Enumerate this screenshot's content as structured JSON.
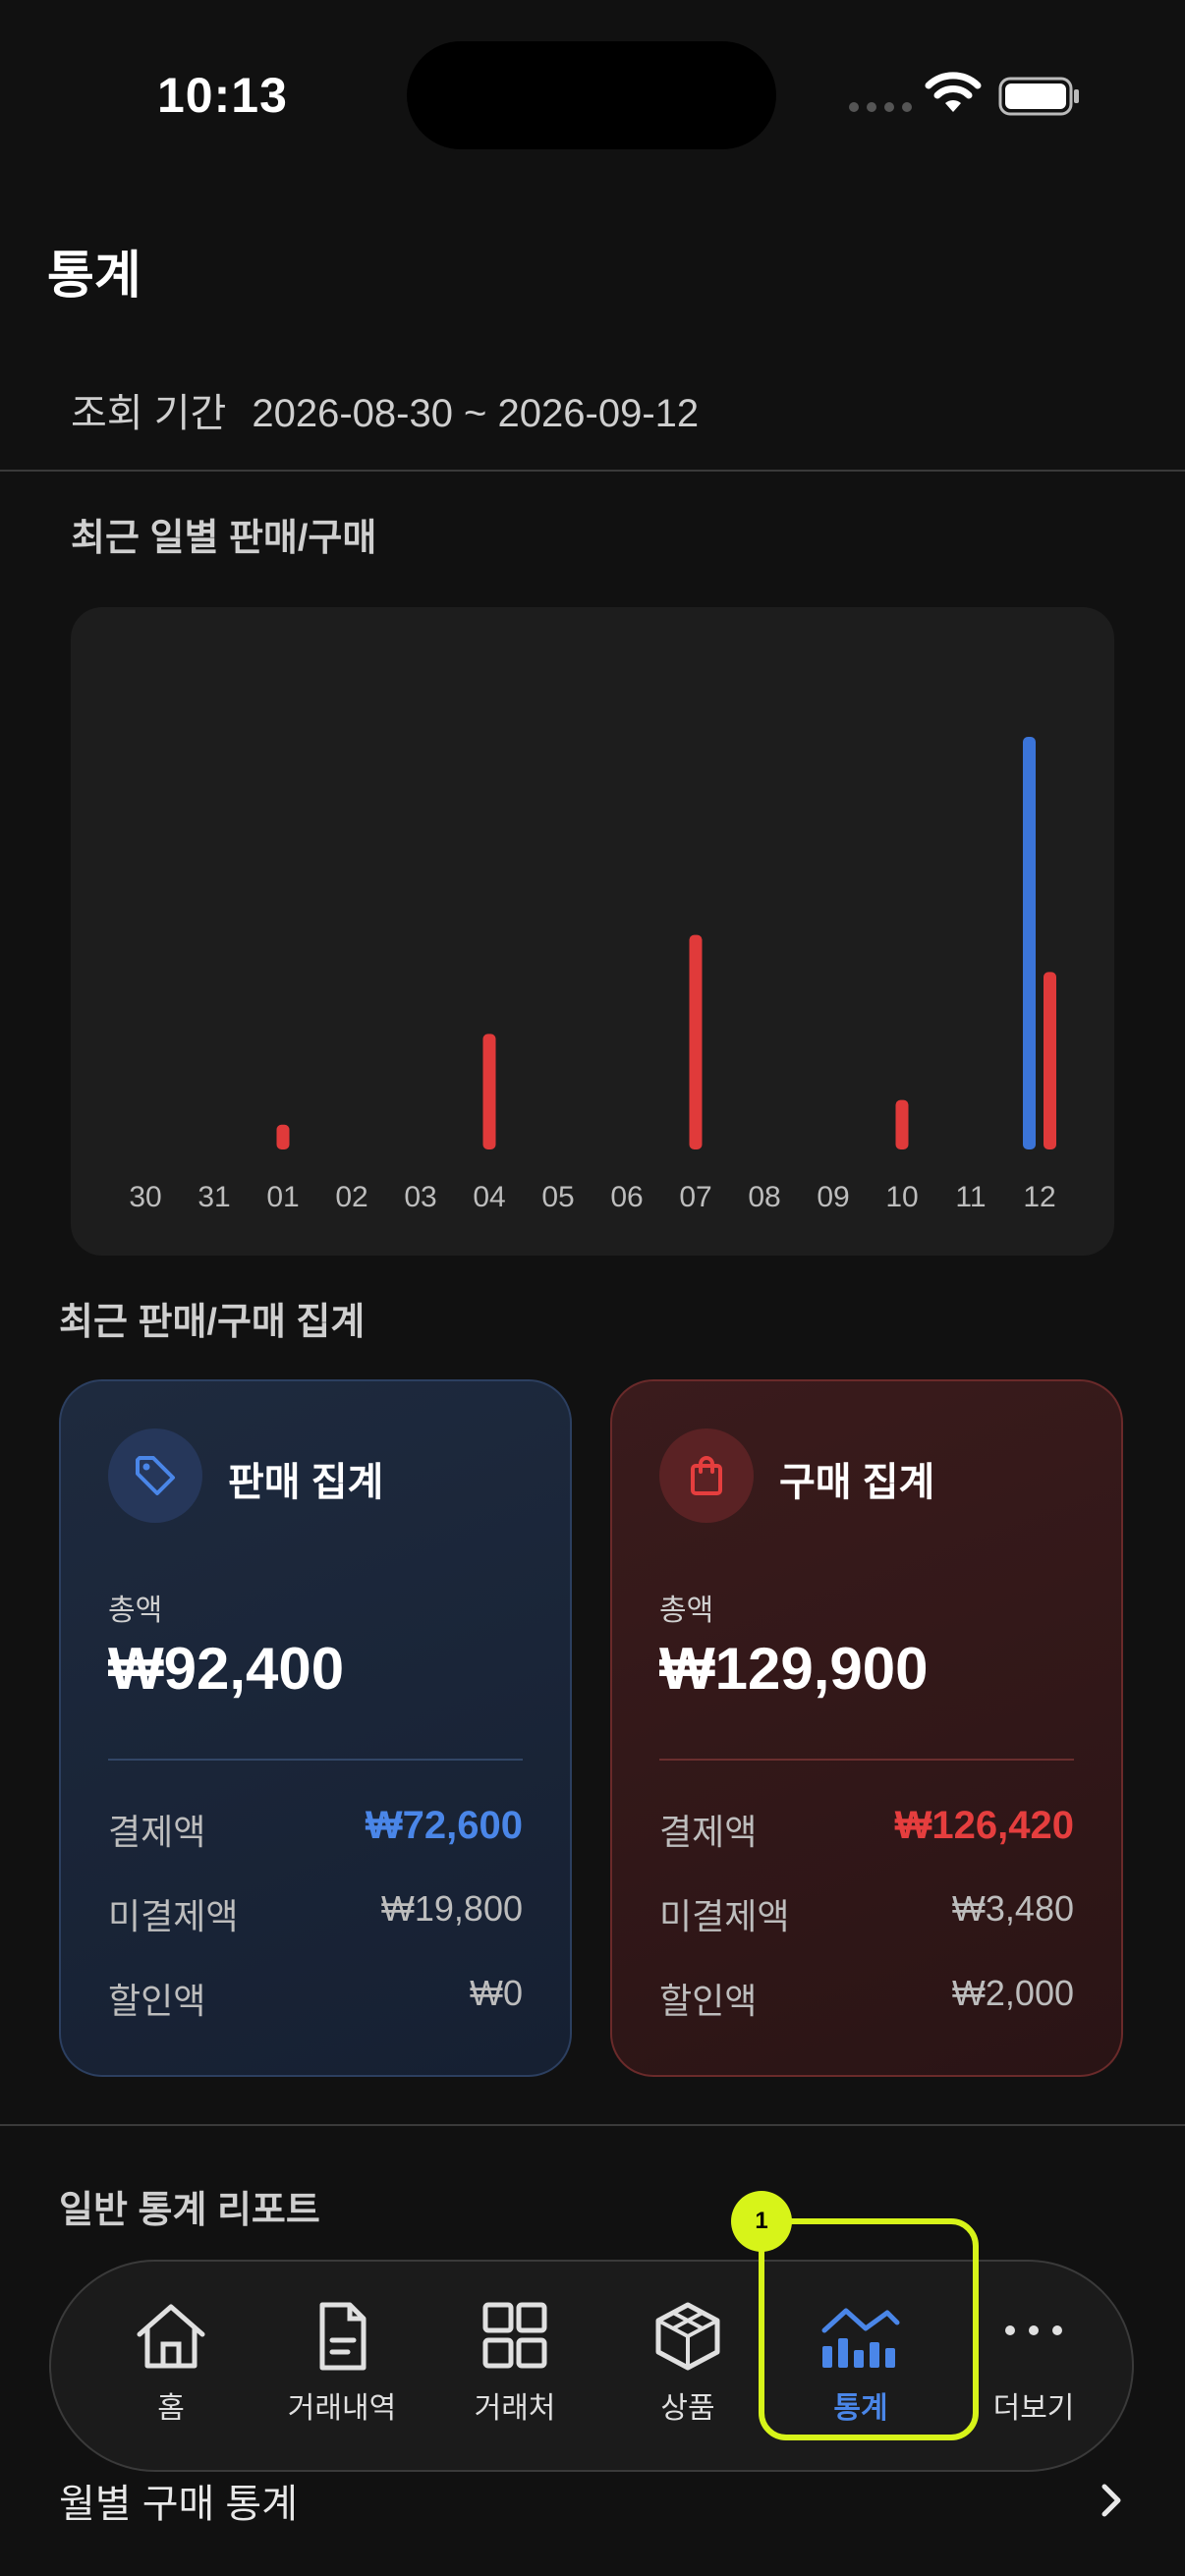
{
  "status_bar": {
    "time": "10:13"
  },
  "page": {
    "title": "통계",
    "period_label": "조회 기간",
    "period_value": "2026-08-30 ~ 2026-09-12"
  },
  "daily_section": {
    "title": "최근 일별 판매/구매"
  },
  "chart_data": {
    "type": "bar",
    "categories": [
      "30",
      "31",
      "01",
      "02",
      "03",
      "04",
      "05",
      "06",
      "07",
      "08",
      "09",
      "10",
      "11",
      "12"
    ],
    "series": [
      {
        "color": "#3b74d8",
        "values": [
          0,
          0,
          0,
          0,
          0,
          0,
          0,
          0,
          0,
          0,
          0,
          0,
          0,
          100
        ]
      },
      {
        "color": "#e03a3a",
        "values": [
          0,
          0,
          6,
          0,
          0,
          28,
          0,
          0,
          52,
          0,
          0,
          12,
          0,
          43
        ]
      }
    ],
    "ylim": [
      0,
      100
    ],
    "grid": false,
    "legend": "none"
  },
  "summary_section": {
    "title": "최근 판매/구매 집계"
  },
  "sale_card": {
    "title": "판매 집계",
    "total_label": "총액",
    "total": "₩92,400",
    "paid_label": "결제액",
    "paid": "₩72,600",
    "unpaid_label": "미결제액",
    "unpaid": "₩19,800",
    "discount_label": "할인액",
    "discount": "₩0"
  },
  "buy_card": {
    "title": "구매 집계",
    "total_label": "총액",
    "total": "₩129,900",
    "paid_label": "결제액",
    "paid": "₩126,420",
    "unpaid_label": "미결제액",
    "unpaid": "₩3,480",
    "discount_label": "할인액",
    "discount": "₩2,000"
  },
  "report_section": {
    "title": "일반 통계 리포트",
    "item_monthly_purchase": "월별 구매 통계"
  },
  "nav": {
    "home": "홈",
    "history": "거래내역",
    "partners": "거래처",
    "products": "상품",
    "stats": "통계",
    "more": "더보기"
  },
  "annotation": {
    "badge": "1"
  },
  "colors": {
    "accent_blue": "#4a86e8",
    "accent_red": "#e53e3e",
    "highlight": "#d7f419"
  }
}
